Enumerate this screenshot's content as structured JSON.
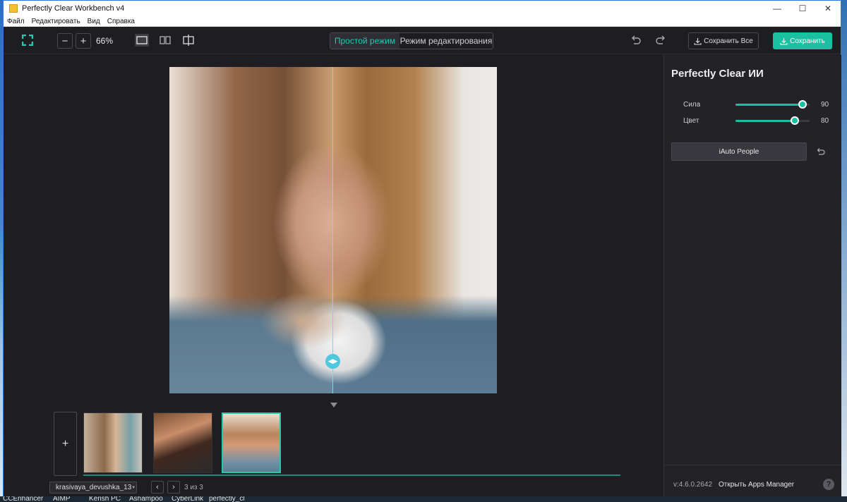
{
  "window": {
    "title": "Perfectly Clear Workbench v4"
  },
  "menu": [
    "Файл",
    "Редактировать",
    "Вид",
    "Справка"
  ],
  "toolbar": {
    "zoom_out": "−",
    "zoom_in": "+",
    "zoom_level": "66%",
    "mode_simple": "Простой режим",
    "mode_edit": "Режим редактирования",
    "save_all": "Сохранить Все",
    "save": "Сохранить"
  },
  "filmstrip": {
    "add_label": "+",
    "file_name": "krasivaya_devushka_13",
    "prev": "‹",
    "next": "›",
    "counter": "3 из 3",
    "thumbnails": [
      {
        "name": "thumb-1",
        "selected": false
      },
      {
        "name": "thumb-2",
        "selected": false
      },
      {
        "name": "thumb-3",
        "selected": true
      }
    ]
  },
  "panel": {
    "title": "Perfectly Clear ИИ",
    "sliders": [
      {
        "label": "Сила",
        "value": "90",
        "fraction": 0.9
      },
      {
        "label": "Цвет",
        "value": "80",
        "fraction": 0.8
      }
    ],
    "preset": "iAuto People",
    "version": "v:4.6.0.2642",
    "apps_manager": "Открыть Apps Manager",
    "help": "?"
  },
  "taskbar": [
    "CCEnhancer",
    "AIMP",
    "Kerish PC",
    "Ashampoo",
    "CyberLink",
    "perfectly_cl"
  ],
  "colors": {
    "accent": "#1bbfa1",
    "panel_bg": "#232327",
    "window_bg": "#1e1e22"
  }
}
